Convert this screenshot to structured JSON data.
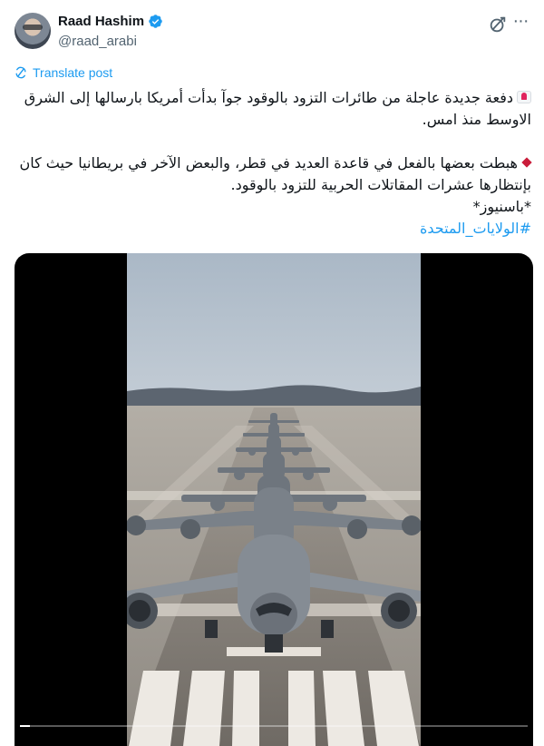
{
  "post": {
    "author": {
      "display_name": "Raad Hashim",
      "handle": "@raad_arabi",
      "verified": true,
      "verified_color": "#1d9bf0"
    },
    "translate_label": "Translate post",
    "paragraph1": "دفعة جديدة عاجلة من طائرات التزود بالوقود جوآ بدأت أمريكا بارسالها إلى الشرق الاوسط منذ امس.",
    "paragraph2": "هبطت بعضها بالفعل في قاعدة العديد في قطر، والبعض الآخر في بريطانيا حيث كان بإنتظارها عشرات المقاتلات الحربية للتزود بالوقود.",
    "credit": "*باسنيوز*",
    "hashtag": "#الولايات_المتحدة",
    "link_color": "#1d9bf0"
  },
  "icons": {
    "siren": "police-car-light-emoji",
    "diamond": "red-diamond-emoji",
    "grok": "grok-icon",
    "more": "more-icon",
    "translate": "translate-icon"
  },
  "media": {
    "kind": "video",
    "subject": "aerial refueling tanker aircraft lined up on runway",
    "progress_fraction": 0.005
  }
}
